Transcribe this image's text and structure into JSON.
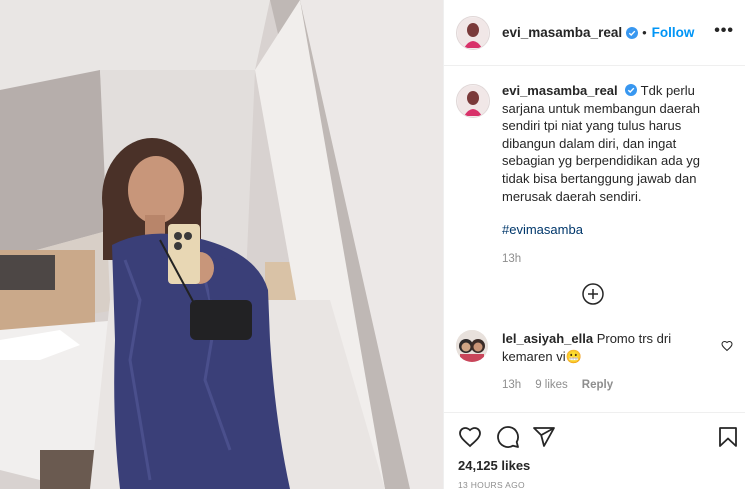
{
  "post": {
    "username": "evi_masamba_real",
    "separator": "•",
    "follow_label": "Follow",
    "more_icon": "more-options-icon",
    "more_label": "•••",
    "caption": {
      "username": "evi_masamba_real",
      "text": "Tdk perlu sarjana untuk membangun daerah sendiri tpi niat yang tulus harus dibangun dalam diri, dan ingat sebagian yg berpendidikan ada yg tidak bisa bertanggung jawab dan merusak daerah sendiri.",
      "hashtag": "#evimasamba",
      "time": "13h"
    },
    "load_more_icon": "plus-circle-icon",
    "comments": [
      {
        "username": "lel_asiyah_ella",
        "text": "Promo trs dri kemaren vi",
        "emoji": "😬",
        "time": "13h",
        "likes": "9 likes",
        "reply_label": "Reply"
      }
    ],
    "likes_count": "24,125 likes",
    "posted_ago": "13 HOURS AGO",
    "colors": {
      "link_blue": "#0095f6",
      "hashtag_blue": "#00376b",
      "verified_blue": "#3897f0",
      "muted_text": "#8e8e8e"
    }
  }
}
